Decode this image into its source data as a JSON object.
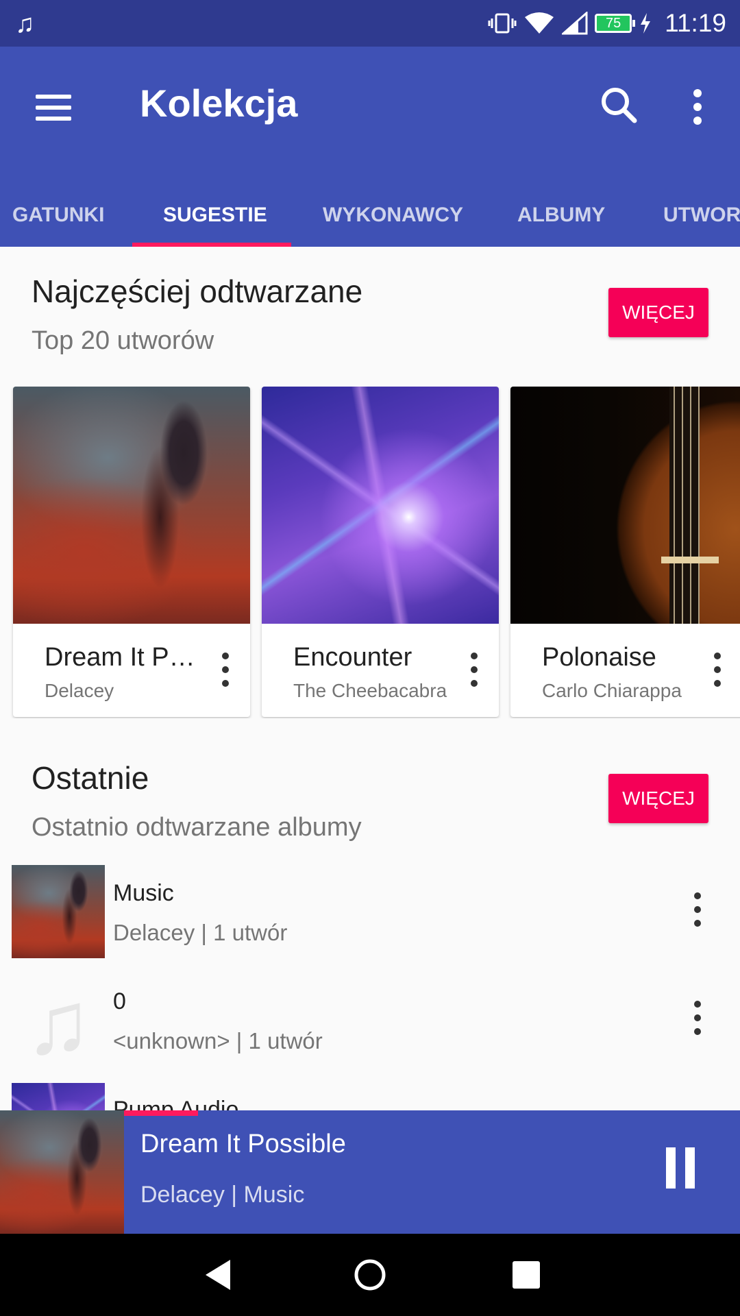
{
  "status_bar": {
    "time": "11:19",
    "battery": "75",
    "icons": [
      "music-note-icon",
      "vibrate-icon",
      "wifi-icon",
      "signal-icon",
      "battery-icon",
      "charging-icon"
    ]
  },
  "app_bar": {
    "title": "Kolekcja",
    "tabs": [
      {
        "label": "GATUNKI",
        "active": false
      },
      {
        "label": "SUGESTIE",
        "active": true
      },
      {
        "label": "WYKONAWCY",
        "active": false
      },
      {
        "label": "ALBUMY",
        "active": false
      },
      {
        "label": "UTWORY",
        "active": false
      }
    ]
  },
  "most_played": {
    "title": "Najczęściej odtwarzane",
    "subtitle": "Top 20 utworów",
    "more_label": "WIĘCEJ",
    "cards": [
      {
        "title": "Dream It Po…",
        "artist": "Delacey"
      },
      {
        "title": "Encounter",
        "artist": "The Cheebacabra"
      },
      {
        "title": "Polonaise",
        "artist": "Carlo Chiarappa"
      }
    ]
  },
  "recent": {
    "title": "Ostatnie",
    "subtitle": "Ostatnio odtwarzane albumy",
    "more_label": "WIĘCEJ",
    "items": [
      {
        "title": "Music",
        "subtitle": "Delacey | 1 utwór"
      },
      {
        "title": "0",
        "subtitle": "<unknown> | 1 utwór"
      },
      {
        "title": "Pump Audio",
        "subtitle": ""
      }
    ]
  },
  "now_playing": {
    "title": "Dream It Possible",
    "subtitle": "Delacey | Music"
  },
  "colors": {
    "primary": "#3f51b5",
    "status_bar": "#2f3a8f",
    "accent": "#f50057"
  }
}
